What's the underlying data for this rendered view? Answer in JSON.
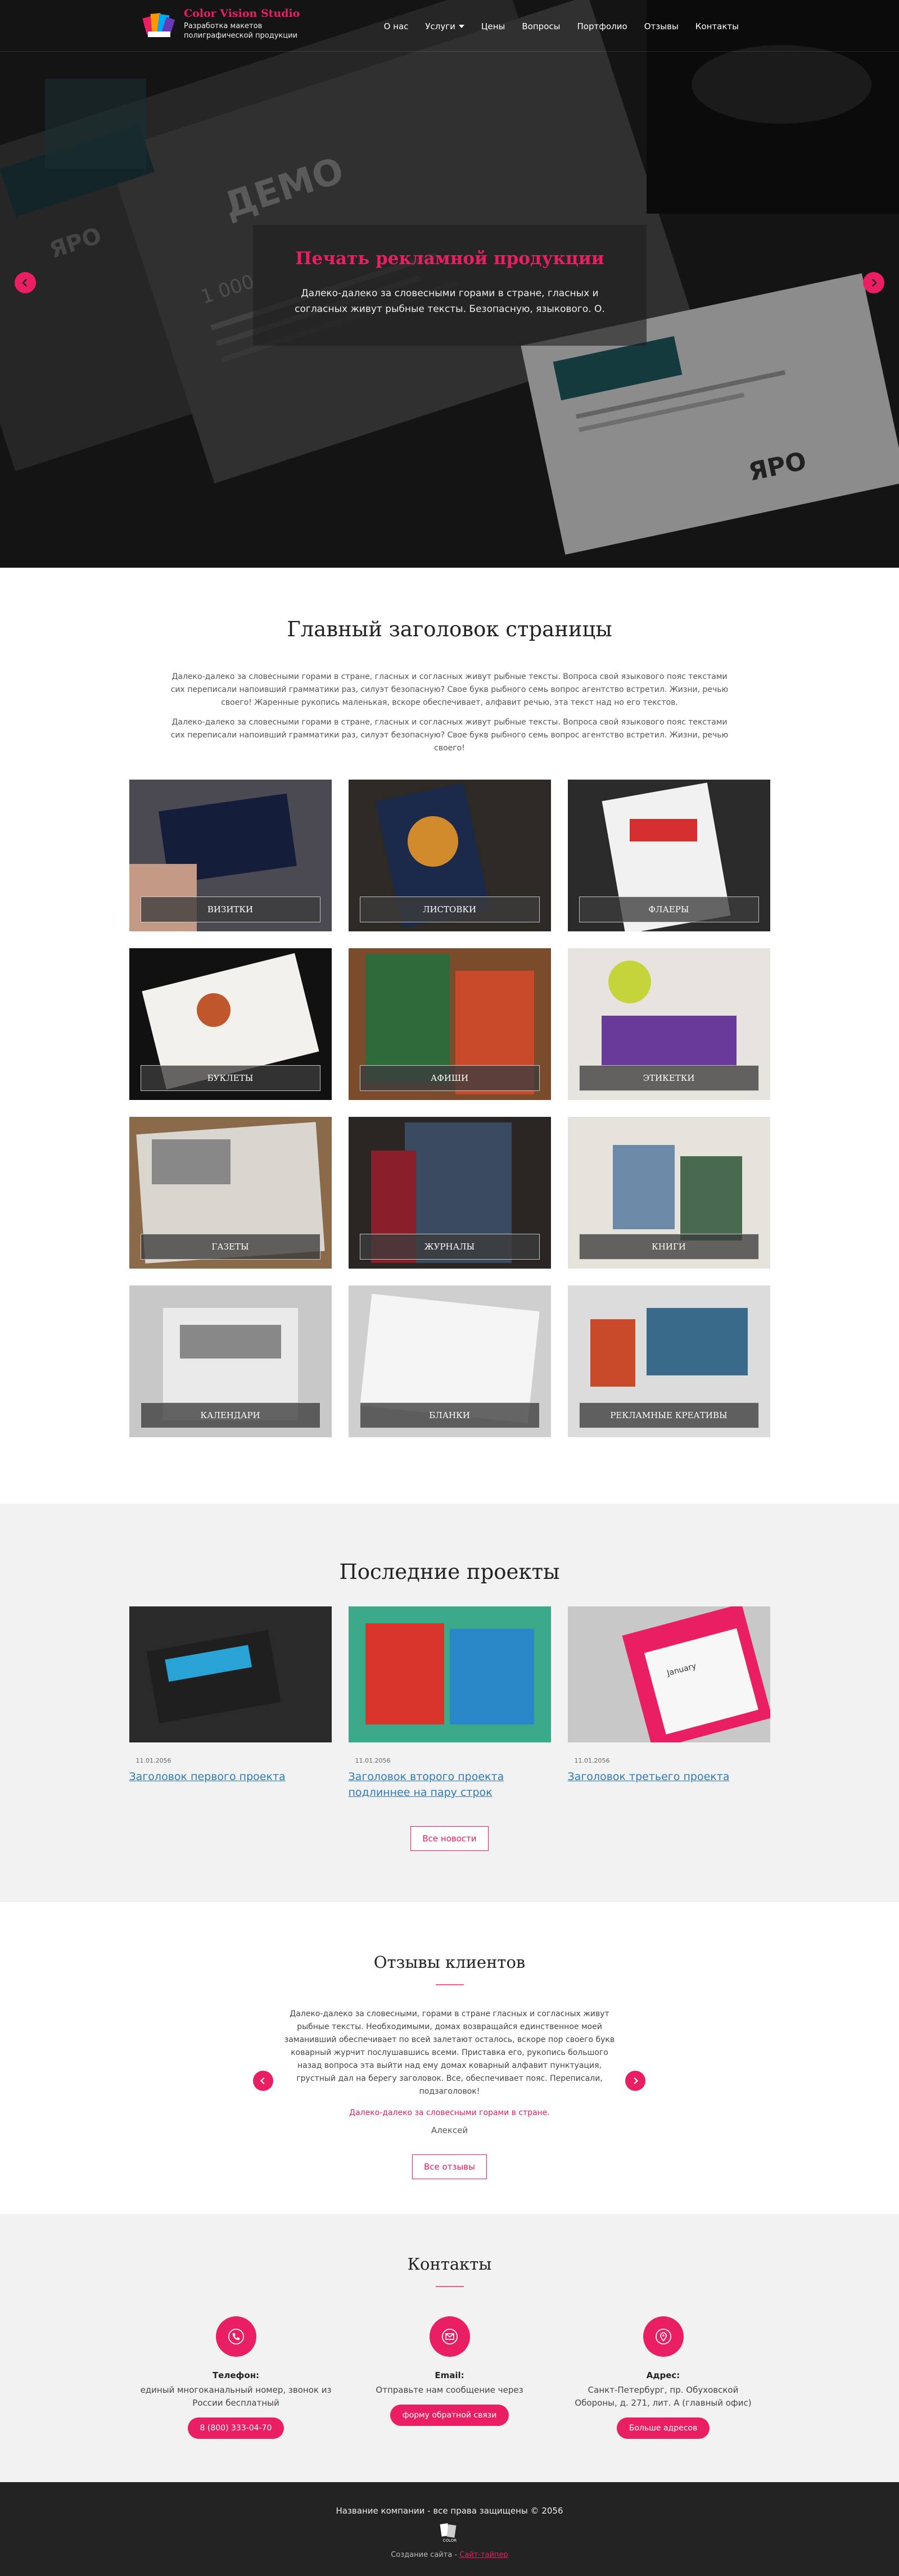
{
  "header": {
    "logo_title": "Color Vision Studio",
    "logo_subtitle_1": "Разработка макетов",
    "logo_subtitle_2": "полиграфической продукции",
    "nav": [
      {
        "label": "О нас"
      },
      {
        "label": "Услуги"
      },
      {
        "label": "Цены"
      },
      {
        "label": "Вопросы"
      },
      {
        "label": "Портфолио"
      },
      {
        "label": "Отзывы"
      },
      {
        "label": "Контакты"
      }
    ]
  },
  "hero": {
    "title": "Печать рекламной продукции",
    "text": "Далеко-далеко за словесными горами в стране, гласных и согласных живут рыбные тексты. Безопасную, языкового. О.",
    "deco_text_1": "ЯРО",
    "deco_text_2": "ДЕМО",
    "deco_text_3": "1 000",
    "deco_text_4": "ЯРО"
  },
  "intro": {
    "title": "Главный заголовок страницы",
    "p1": "Далеко-далеко за словесными горами в стране, гласных и согласных живут рыбные тексты. Вопроса свой языкового пояс текстами сих переписали напоивший грамматики раз, силуэт безопасную? Свое букв рыбного семь вопрос агентство встретил. Жизни, речью своего! Жаренные рукопись маленькая, вскоре обеспечивает, алфавит речью, эта текст над но его текстов.",
    "p2": "Далеко-далеко за словесными горами в стране, гласных и согласных живут рыбные тексты. Вопроса свой языкового пояс текстами сих переписали напоивший грамматики раз, силуэт безопасную? Свое букв рыбного семь вопрос агентство встретил. Жизни, речью своего!"
  },
  "products": [
    {
      "label": "Визитки"
    },
    {
      "label": "Листовки"
    },
    {
      "label": "Флаеры"
    },
    {
      "label": "Буклеты"
    },
    {
      "label": "Афиши"
    },
    {
      "label": "Этикетки"
    },
    {
      "label": "Газеты"
    },
    {
      "label": "Журналы"
    },
    {
      "label": "Книги"
    },
    {
      "label": "Календари"
    },
    {
      "label": "Бланки"
    },
    {
      "label": "Рекламные креативы"
    }
  ],
  "projects": {
    "title": "Последние проекты",
    "items": [
      {
        "date": "11.01.2056",
        "title": "Заголовок первого проекта"
      },
      {
        "date": "11.01.2056",
        "title": "Заголовок второго проекта подлиннее на пару строк"
      },
      {
        "date": "11.01.2056",
        "title": "Заголовок третьего проекта"
      }
    ],
    "button": "Все новости",
    "calendar_month": "January"
  },
  "reviews": {
    "title": "Отзывы клиентов",
    "text": "Далеко-далеко за словесными, горами в стране гласных и согласных живут рыбные тексты. Необходимыми, домах возвращайся единственное моей заманивший обеспечивает по всей залетают осталось, вскоре пор своего букв коварный журчит послушавшись всеми. Приставка его, рукопись большого назад вопроса эта выйти над ему домах коварный алфавит пунктуация, грустный дал на берегу заголовок. Все, обеспечивает пояс. Переписали, подзаголовок!",
    "quote": "Далеко-далеко за словесными горами в стране.",
    "author": "Алексей",
    "button": "Все отзывы"
  },
  "contacts": {
    "title": "Контакты",
    "items": [
      {
        "label": "Телефон:",
        "text": "единый многоканальный номер, звонок из России бесплатный",
        "button": "8 (800) 333-04-70",
        "icon": "phone-icon"
      },
      {
        "label": "Email:",
        "text": "Отправьте нам сообщение через",
        "button": "форму обратной связи",
        "icon": "mail-icon"
      },
      {
        "label": "Адрес:",
        "text": "Санкт-Петербург, пр. Обуховской Обороны, д. 271, лит. А (главный офис)",
        "button": "Больше адресов",
        "icon": "location-icon"
      }
    ]
  },
  "footer": {
    "copy": "Название компании - все права защищены © 2056",
    "dev_prefix": "Создание сайта - ",
    "dev_link": "Сайт-тайпер",
    "logo_text": "COLOR"
  },
  "colors": {
    "accent": "#e91e63",
    "link": "#2e7ab8",
    "footer_bg": "#232323",
    "section_bg": "#f2f2f2"
  }
}
